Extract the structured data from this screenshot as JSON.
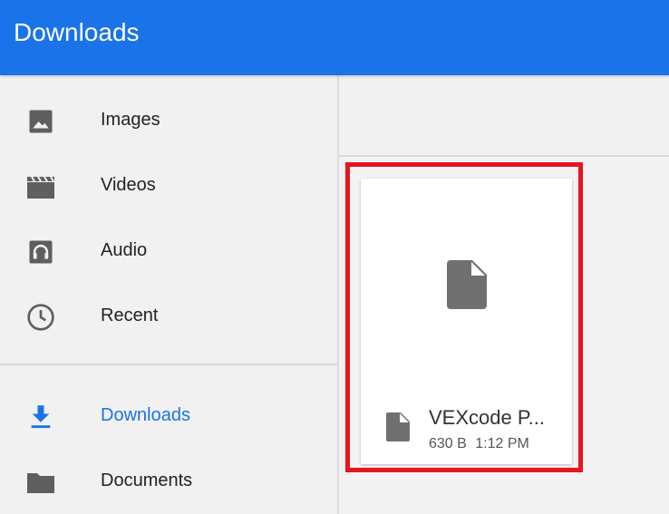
{
  "appbar": {
    "title": "Downloads"
  },
  "sidebar": {
    "items": [
      {
        "label": "Images",
        "icon": "image-icon",
        "active": false
      },
      {
        "label": "Videos",
        "icon": "videos-icon",
        "active": false
      },
      {
        "label": "Audio",
        "icon": "audio-icon",
        "active": false
      },
      {
        "label": "Recent",
        "icon": "recent-clock-icon",
        "active": false
      },
      {
        "label": "Downloads",
        "icon": "download-icon",
        "active": true
      },
      {
        "label": "Documents",
        "icon": "folder-icon",
        "active": false
      }
    ]
  },
  "files": [
    {
      "name": "VEXcode P...",
      "size": "630 B",
      "time": "1:12 PM",
      "icon": "file-icon"
    }
  ],
  "colors": {
    "accent": "#1a73e8",
    "highlight": "#e8141e",
    "icon_gray": "#5f5f5f"
  }
}
